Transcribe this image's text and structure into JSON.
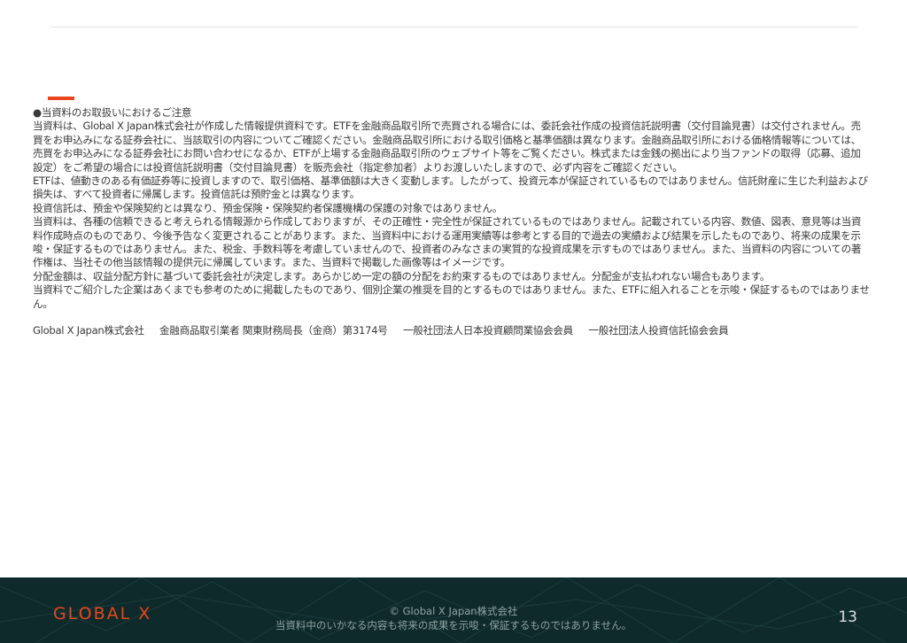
{
  "disclaimer": {
    "heading": "●当資料のお取扱いにおけるご注意",
    "paragraphs": [
      "当資料は、Global X Japan株式会社が作成した情報提供資料です。ETFを金融商品取引所で売買される場合には、委託会社作成の投資信託説明書（交付目論見書）は交付されません。売買をお申込みになる証券会社に、当該取引の内容についてご確認ください。金融商品取引所における取引価格と基準価額は異なります。金融商品取引所における価格情報等については、売買をお申込みになる証券会社にお問い合わせになるか、ETFが上場する金融商品取引所のウェブサイト等をご覧ください。株式または金銭の拠出により当ファンドの取得（応募、追加設定）をご希望の場合には投資信託説明書（交付目論見書）を販売会社（指定参加者）よりお渡しいたしますので、必ず内容をご確認ください。",
      "ETFは、値動きのある有価証券等に投資しますので、取引価格、基準価額は大きく変動します。したがって、投資元本が保証されているものではありません。信託財産に生じた利益および損失は、すべて投資者に帰属します。投資信託は預貯金とは異なります。",
      "投資信託は、預金や保険契約とは異なり、預金保険・保険契約者保護機構の保護の対象ではありません。",
      "当資料は、各種の信頼できると考えられる情報源から作成しておりますが、その正確性・完全性が保証されているものではありません。記載されている内容、数値、図表、意見等は当資料作成時点のものであり、今後予告なく変更されることがあります。また、当資料中における運用実績等は参考とする目的で過去の実績および結果を示したものであり、将来の成果を示唆・保証するものではありません。また、税金、手数料等を考慮していませんので、投資者のみなさまの実質的な投資成果を示すものではありません。また、当資料の内容についての著作権は、当社その他当該情報の提供元に帰属しています。また、当資料で掲載した画像等はイメージです。",
      "分配金額は、収益分配方針に基づいて委託会社が決定します。あらかじめ一定の額の分配をお約束するものではありません。分配金が支払われない場合もあります。",
      "当資料でご紹介した企業はあくまでも参考のために掲載したものであり、個別企業の推奨を目的とするものではありません。また、ETFに組入れることを示唆・保証するものではありません。"
    ],
    "company_line": {
      "company": "Global X Japan株式会社",
      "registration": "金融商品取引業者 関東財務局長（金商）第3174号",
      "association1": "一般社団法人日本投資顧問業協会会員",
      "association2": "一般社団法人投資信託協会会員"
    }
  },
  "footer": {
    "logo": "GLOBAL X",
    "copyright": "© Global X Japan株式会社",
    "notice": "当資料中のいかなる内容も将来の成果を示唆・保証するものではありません。",
    "page_number": "13",
    "background_color": "#0e2a2b",
    "logo_color": "#e8461b"
  },
  "accent_color": "#e8461b"
}
